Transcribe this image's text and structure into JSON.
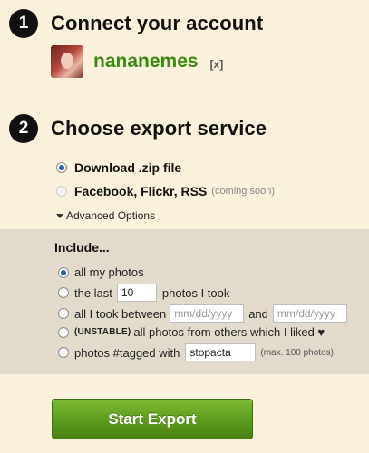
{
  "step1": {
    "number": "1",
    "title": "Connect your account"
  },
  "account": {
    "username": "nananemes",
    "remove_label": "[x]"
  },
  "step2": {
    "number": "2",
    "title": "Choose export service"
  },
  "services": [
    {
      "label": "Download .zip file",
      "selected": true,
      "note": ""
    },
    {
      "label": "Facebook, Flickr, RSS",
      "selected": false,
      "note": "(coming soon)"
    }
  ],
  "advanced": {
    "label": "Advanced Options",
    "expanded": true
  },
  "include": {
    "title": "Include...",
    "all_photos": "all my photos",
    "last_prefix": "the last",
    "last_count": "10",
    "last_suffix": "photos I took",
    "between_prefix": "all I took between",
    "date_placeholder": "mm/dd/yyyy",
    "between_and": "and",
    "unstable_tag": "(UNSTABLE)",
    "liked_text": "all photos from others which I liked ♥",
    "tagged_prefix": "photos #tagged with",
    "tag_value": "stopacta",
    "tag_note": "(max. 100 photos)"
  },
  "action": {
    "start_label": "Start Export"
  }
}
